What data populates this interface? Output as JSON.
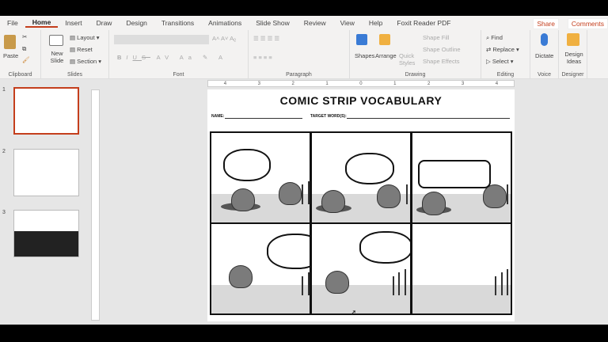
{
  "tabs": [
    "File",
    "Home",
    "Insert",
    "Draw",
    "Design",
    "Transitions",
    "Animations",
    "Slide Show",
    "Review",
    "View",
    "Help",
    "Foxit Reader PDF"
  ],
  "active_tab": "Home",
  "share": "Share",
  "comments": "Comments",
  "ribbon": {
    "clipboard": {
      "label": "Clipboard",
      "paste": "Paste"
    },
    "slides": {
      "label": "Slides",
      "new_slide": "New Slide",
      "layout": "Layout",
      "reset": "Reset",
      "section": "Section"
    },
    "font": {
      "label": "Font",
      "bold": "B",
      "italic": "I",
      "underline": "U",
      "strike": "S"
    },
    "paragraph": {
      "label": "Paragraph"
    },
    "drawing": {
      "label": "Drawing",
      "shapes": "Shapes",
      "arrange": "Arrange",
      "quick_styles": "Quick Styles",
      "shape_fill": "Shape Fill",
      "shape_outline": "Shape Outline",
      "shape_effects": "Shape Effects"
    },
    "editing": {
      "label": "Editing",
      "find": "Find",
      "replace": "Replace",
      "select": "Select"
    },
    "voice": {
      "label": "Voice",
      "dictate": "Dictate"
    },
    "designer": {
      "label": "Designer",
      "design_ideas": "Design Ideas"
    }
  },
  "thumbnails": [
    {
      "num": "1",
      "selected": true
    },
    {
      "num": "2",
      "selected": false
    },
    {
      "num": "3",
      "selected": false
    }
  ],
  "ruler": [
    "4",
    "3",
    "2",
    "1",
    "0",
    "1",
    "2",
    "3",
    "4"
  ],
  "slide": {
    "title": "COMIC STRIP VOCABULARY",
    "name_label": "NAME:",
    "target_label": "TARGET WORD(S):"
  },
  "colors": {
    "accent": "#c43e1c",
    "ribbon": "#f3f2f1"
  }
}
